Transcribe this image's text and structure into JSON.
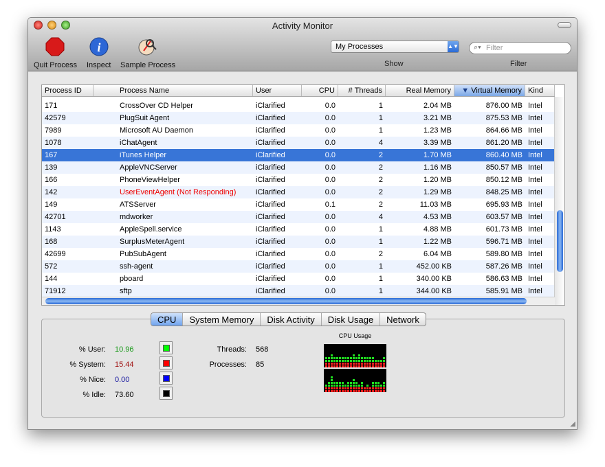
{
  "window": {
    "title": "Activity Monitor"
  },
  "toolbar": {
    "quit": "Quit Process",
    "inspect": "Inspect",
    "sample": "Sample Process",
    "show_value": "My Processes",
    "show_label": "Show",
    "filter_placeholder": "Filter",
    "filter_label": "Filter"
  },
  "table": {
    "columns": [
      "Process ID",
      "Process Name",
      "User",
      "CPU",
      "# Threads",
      "Real Memory",
      "Virtual Memory",
      "Kind"
    ],
    "sorted_column": "Virtual Memory",
    "selected_pid": "167",
    "rows": [
      [
        "171",
        "CrossOver CD Helper",
        "iClarified",
        "0.0",
        "1",
        "2.04 MB",
        "876.00 MB",
        "Intel"
      ],
      [
        "42579",
        "PlugSuit Agent",
        "iClarified",
        "0.0",
        "1",
        "3.21 MB",
        "875.53 MB",
        "Intel"
      ],
      [
        "7989",
        "Microsoft AU Daemon",
        "iClarified",
        "0.0",
        "1",
        "1.23 MB",
        "864.66 MB",
        "Intel"
      ],
      [
        "1078",
        "iChatAgent",
        "iClarified",
        "0.0",
        "4",
        "3.39 MB",
        "861.20 MB",
        "Intel"
      ],
      [
        "167",
        "iTunes Helper",
        "iClarified",
        "0.0",
        "2",
        "1.70 MB",
        "860.40 MB",
        "Intel"
      ],
      [
        "139",
        "AppleVNCServer",
        "iClarified",
        "0.0",
        "2",
        "1.16 MB",
        "850.57 MB",
        "Intel"
      ],
      [
        "166",
        "PhoneViewHelper",
        "iClarified",
        "0.0",
        "2",
        "1.20 MB",
        "850.12 MB",
        "Intel"
      ],
      [
        "142",
        "UserEventAgent (Not Responding)",
        "iClarified",
        "0.0",
        "2",
        "1.29 MB",
        "848.25 MB",
        "Intel"
      ],
      [
        "149",
        "ATSServer",
        "iClarified",
        "0.1",
        "2",
        "11.03 MB",
        "695.93 MB",
        "Intel"
      ],
      [
        "42701",
        "mdworker",
        "iClarified",
        "0.0",
        "4",
        "4.53 MB",
        "603.57 MB",
        "Intel"
      ],
      [
        "1143",
        "AppleSpell.service",
        "iClarified",
        "0.0",
        "1",
        "4.88 MB",
        "601.73 MB",
        "Intel"
      ],
      [
        "168",
        "SurplusMeterAgent",
        "iClarified",
        "0.0",
        "1",
        "1.22 MB",
        "596.71 MB",
        "Intel"
      ],
      [
        "42699",
        "PubSubAgent",
        "iClarified",
        "0.0",
        "2",
        "6.04 MB",
        "589.80 MB",
        "Intel"
      ],
      [
        "572",
        "ssh-agent",
        "iClarified",
        "0.0",
        "1",
        "452.00 KB",
        "587.26 MB",
        "Intel"
      ],
      [
        "144",
        "pboard",
        "iClarified",
        "0.0",
        "1",
        "340.00 KB",
        "586.63 MB",
        "Intel"
      ],
      [
        "71912",
        "sftp",
        "iClarified",
        "0.0",
        "1",
        "344.00 KB",
        "585.91 MB",
        "Intel"
      ]
    ]
  },
  "tabs": [
    "CPU",
    "System Memory",
    "Disk Activity",
    "Disk Usage",
    "Network"
  ],
  "active_tab": "CPU",
  "cpu": {
    "user_label": "% User:",
    "user": "10.96",
    "user_color": "#00c000",
    "system_label": "% System:",
    "system": "15.44",
    "system_color": "#c00000",
    "nice_label": "% Nice:",
    "nice": "0.00",
    "nice_color": "#0000c0",
    "idle_label": "% Idle:",
    "idle": "73.60",
    "threads_label": "Threads:",
    "threads": "568",
    "processes_label": "Processes:",
    "processes": "85",
    "graph_title": "CPU Usage",
    "graph1_system": [
      2,
      2,
      2,
      2,
      2,
      2,
      2,
      2,
      2,
      2,
      2,
      2,
      2,
      2,
      2,
      2,
      2,
      2,
      2,
      2,
      2,
      2
    ],
    "graph1_user": [
      2,
      2,
      3,
      2,
      2,
      2,
      2,
      2,
      2,
      2,
      3,
      2,
      3,
      2,
      2,
      2,
      2,
      2,
      1,
      1,
      1,
      2
    ],
    "graph2_system": [
      2,
      2,
      2,
      2,
      2,
      2,
      2,
      2,
      2,
      2,
      2,
      2,
      2,
      2,
      2,
      2,
      2,
      2,
      2,
      2,
      2,
      2
    ],
    "graph2_user": [
      1,
      2,
      4,
      2,
      2,
      2,
      2,
      1,
      2,
      2,
      3,
      2,
      1,
      2,
      0,
      1,
      0,
      2,
      2,
      2,
      1,
      2
    ]
  }
}
